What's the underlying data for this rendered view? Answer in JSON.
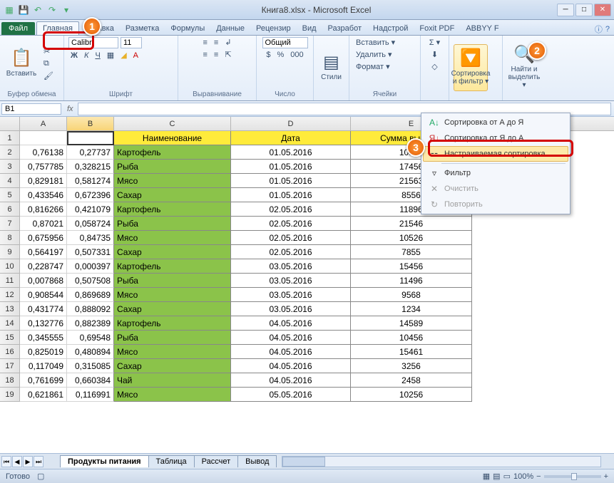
{
  "window": {
    "title": "Книга8.xlsx - Microsoft Excel"
  },
  "tabs": {
    "file": "Файл",
    "items": [
      "Главная",
      "Вставка",
      "Разметка",
      "Формулы",
      "Данные",
      "Рецензир",
      "Вид",
      "Разработ",
      "Надстрой",
      "Foxit PDF",
      "ABBYY F"
    ]
  },
  "ribbon": {
    "paste": "Вставить",
    "clipboard": "Буфер обмена",
    "font_name": "Calibri",
    "font_size": "11",
    "font_group": "Шрифт",
    "align_group": "Выравнивание",
    "number_format": "Общий",
    "number_group": "Число",
    "styles": "Стили",
    "insert": "Вставить ▾",
    "delete": "Удалить ▾",
    "format": "Формат ▾",
    "cells_group": "Ячейки",
    "autosum": "Σ ▾",
    "sort_filter": "Сортировка и фильтр ▾",
    "find_select": "Найти и выделить ▾"
  },
  "namebox": "B1",
  "columns": [
    "A",
    "B",
    "C",
    "D",
    "E"
  ],
  "headers": {
    "c": "Наименование",
    "d": "Дата",
    "e": "Сумма выручки"
  },
  "rows": [
    {
      "n": 1,
      "a": "",
      "b": "",
      "c": "Наименование",
      "d": "Дата",
      "e": "Сумма выручки",
      "hdr": true
    },
    {
      "n": 2,
      "a": "0,76138",
      "b": "0,27737",
      "c": "Картофель",
      "d": "01.05.2016",
      "e": "10526"
    },
    {
      "n": 3,
      "a": "0,757785",
      "b": "0,328215",
      "c": "Рыба",
      "d": "01.05.2016",
      "e": "17456"
    },
    {
      "n": 4,
      "a": "0,829181",
      "b": "0,581274",
      "c": "Мясо",
      "d": "01.05.2016",
      "e": "21563"
    },
    {
      "n": 5,
      "a": "0,433546",
      "b": "0,672396",
      "c": "Сахар",
      "d": "01.05.2016",
      "e": "8556"
    },
    {
      "n": 6,
      "a": "0,816266",
      "b": "0,421079",
      "c": "Картофель",
      "d": "02.05.2016",
      "e": "11896"
    },
    {
      "n": 7,
      "a": "0,87021",
      "b": "0,058724",
      "c": "Рыба",
      "d": "02.05.2016",
      "e": "21546"
    },
    {
      "n": 8,
      "a": "0,675956",
      "b": "0,84735",
      "c": "Мясо",
      "d": "02.05.2016",
      "e": "10526"
    },
    {
      "n": 9,
      "a": "0,564197",
      "b": "0,507331",
      "c": "Сахар",
      "d": "02.05.2016",
      "e": "7855"
    },
    {
      "n": 10,
      "a": "0,228747",
      "b": "0,000397",
      "c": "Картофель",
      "d": "03.05.2016",
      "e": "15456"
    },
    {
      "n": 11,
      "a": "0,007868",
      "b": "0,507508",
      "c": "Рыба",
      "d": "03.05.2016",
      "e": "11496"
    },
    {
      "n": 12,
      "a": "0,908544",
      "b": "0,869689",
      "c": "Мясо",
      "d": "03.05.2016",
      "e": "9568"
    },
    {
      "n": 13,
      "a": "0,431774",
      "b": "0,888092",
      "c": "Сахар",
      "d": "03.05.2016",
      "e": "1234"
    },
    {
      "n": 14,
      "a": "0,132776",
      "b": "0,882389",
      "c": "Картофель",
      "d": "04.05.2016",
      "e": "14589"
    },
    {
      "n": 15,
      "a": "0,345555",
      "b": "0,69548",
      "c": "Рыба",
      "d": "04.05.2016",
      "e": "10456"
    },
    {
      "n": 16,
      "a": "0,825019",
      "b": "0,480894",
      "c": "Мясо",
      "d": "04.05.2016",
      "e": "15461"
    },
    {
      "n": 17,
      "a": "0,117049",
      "b": "0,315085",
      "c": "Сахар",
      "d": "04.05.2016",
      "e": "3256"
    },
    {
      "n": 18,
      "a": "0,761699",
      "b": "0,660384",
      "c": "Чай",
      "d": "04.05.2016",
      "e": "2458"
    },
    {
      "n": 19,
      "a": "0,621861",
      "b": "0,116991",
      "c": "Мясо",
      "d": "05.05.2016",
      "e": "10256"
    }
  ],
  "sheets": [
    "Продукты питания",
    "Таблица",
    "Рассчет",
    "Вывод"
  ],
  "status": {
    "ready": "Готово",
    "zoom": "100%"
  },
  "menu": {
    "az": "Сортировка от А до Я",
    "za": "Сортировка от Я до А",
    "custom": "Настраиваемая сортировка...",
    "filter": "Фильтр",
    "clear": "Очистить",
    "reapply": "Повторить"
  },
  "callouts": {
    "c1": "1",
    "c2": "2",
    "c3": "3"
  }
}
